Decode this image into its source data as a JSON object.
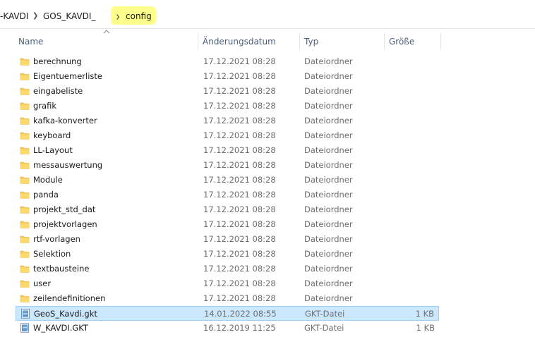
{
  "breadcrumb": {
    "segments": [
      "-KAVDI",
      "GOS_KAVDI_",
      "config"
    ],
    "highlight_color": "#ffff8c"
  },
  "columns": {
    "name": "Name",
    "date": "Änderungsdatum",
    "type": "Typ",
    "size": "Größe"
  },
  "files": [
    {
      "name": "berechnung",
      "date": "17.12.2021 08:28",
      "type": "Dateiordner",
      "size": "",
      "icon": "folder-icon"
    },
    {
      "name": "Eigentuemerliste",
      "date": "17.12.2021 08:28",
      "type": "Dateiordner",
      "size": "",
      "icon": "folder-icon"
    },
    {
      "name": "eingabeliste",
      "date": "17.12.2021 08:28",
      "type": "Dateiordner",
      "size": "",
      "icon": "folder-icon"
    },
    {
      "name": "grafik",
      "date": "17.12.2021 08:28",
      "type": "Dateiordner",
      "size": "",
      "icon": "folder-icon"
    },
    {
      "name": "kafka-konverter",
      "date": "17.12.2021 08:28",
      "type": "Dateiordner",
      "size": "",
      "icon": "folder-icon"
    },
    {
      "name": "keyboard",
      "date": "17.12.2021 08:28",
      "type": "Dateiordner",
      "size": "",
      "icon": "folder-icon"
    },
    {
      "name": "LL-Layout",
      "date": "17.12.2021 08:28",
      "type": "Dateiordner",
      "size": "",
      "icon": "folder-icon"
    },
    {
      "name": "messauswertung",
      "date": "17.12.2021 08:28",
      "type": "Dateiordner",
      "size": "",
      "icon": "folder-icon"
    },
    {
      "name": "Module",
      "date": "17.12.2021 08:28",
      "type": "Dateiordner",
      "size": "",
      "icon": "folder-icon"
    },
    {
      "name": "panda",
      "date": "17.12.2021 08:28",
      "type": "Dateiordner",
      "size": "",
      "icon": "folder-icon"
    },
    {
      "name": "projekt_std_dat",
      "date": "17.12.2021 08:28",
      "type": "Dateiordner",
      "size": "",
      "icon": "folder-icon"
    },
    {
      "name": "projektvorlagen",
      "date": "17.12.2021 08:28",
      "type": "Dateiordner",
      "size": "",
      "icon": "folder-icon"
    },
    {
      "name": "rtf-vorlagen",
      "date": "17.12.2021 08:28",
      "type": "Dateiordner",
      "size": "",
      "icon": "folder-icon"
    },
    {
      "name": "Selektion",
      "date": "17.12.2021 08:28",
      "type": "Dateiordner",
      "size": "",
      "icon": "folder-icon"
    },
    {
      "name": "textbausteine",
      "date": "17.12.2021 08:28",
      "type": "Dateiordner",
      "size": "",
      "icon": "folder-icon"
    },
    {
      "name": "user",
      "date": "17.12.2021 08:28",
      "type": "Dateiordner",
      "size": "",
      "icon": "folder-icon"
    },
    {
      "name": "zeilendefinitionen",
      "date": "17.12.2021 08:28",
      "type": "Dateiordner",
      "size": "",
      "icon": "folder-icon"
    },
    {
      "name": "GeoS_Kavdi.gkt",
      "date": "14.01.2022 08:55",
      "type": "GKT-Datei",
      "size": "1 KB",
      "icon": "file-icon",
      "selected": true
    },
    {
      "name": "W_KAVDI.GKT",
      "date": "16.12.2019 11:25",
      "type": "GKT-Datei",
      "size": "1 KB",
      "icon": "file-icon"
    }
  ],
  "colors": {
    "folder": "#f8c857",
    "selection_bg": "#cce8ff",
    "selection_border": "#99d1ff",
    "header_text": "#4c607a"
  }
}
